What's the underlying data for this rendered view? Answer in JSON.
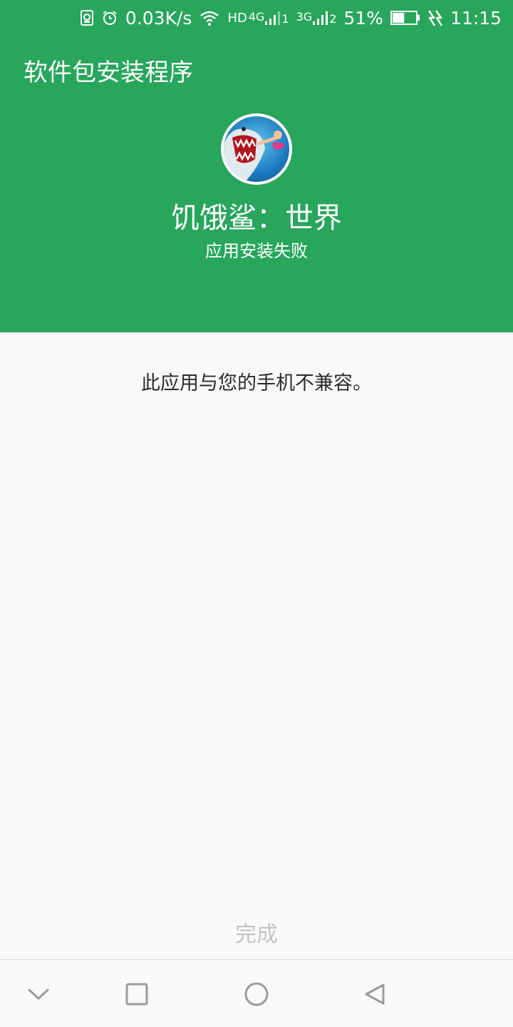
{
  "status_bar": {
    "net_speed": "0.03K/s",
    "hd_label": "HD",
    "sim1_type": "4G",
    "sim1_index": "1",
    "sim2_type": "3G",
    "sim2_index": "2",
    "battery": "51%",
    "battery_level": 0.51,
    "time": "11:15"
  },
  "header": {
    "title": "软件包安装程序",
    "app_name": "饥饿鲨：世界",
    "install_status": "应用安装失败",
    "background_color": "#27a65c"
  },
  "main": {
    "message": "此应用与您的手机不兼容。"
  },
  "footer": {
    "done_label": "完成"
  },
  "navbar": {
    "icons": [
      "chevron-down-icon",
      "recents-square-icon",
      "home-circle-icon",
      "back-triangle-icon"
    ]
  }
}
